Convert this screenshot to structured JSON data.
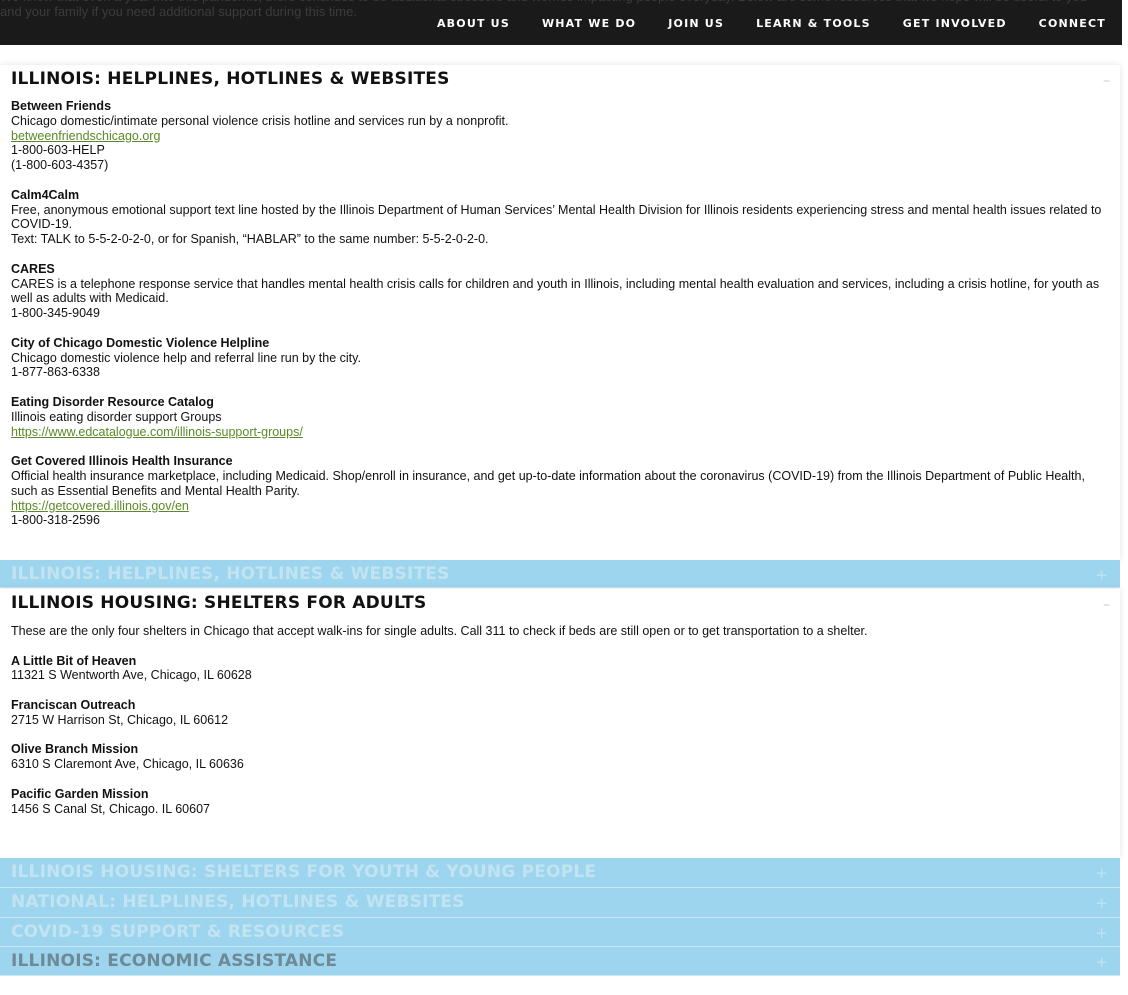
{
  "header": {
    "intro_text": "We know that even a year into this pandemic, there continues to be additional stressors and worries impacting people everyday. Below are some resources that we hope will be useful to you and your family if you need additional support during this time.",
    "nav": [
      "ABOUT US",
      "WHAT WE DO",
      "JOIN US",
      "LEARN & TOOLS",
      "GET INVOLVED",
      "CONNECT"
    ]
  },
  "panel1": {
    "title": "ILLINOIS: HELPLINES, HOTLINES & WEBSITES",
    "toggle": "–",
    "entries": [
      {
        "name": "Between Friends",
        "lines": [
          "Chicago domestic/intimate personal violence crisis hotline and services run by a nonprofit."
        ],
        "link": "betweenfriendschicago.org ",
        "after": [
          "1-800-603-HELP",
          "(1-800-603-4357)"
        ]
      },
      {
        "name": "Calm4Calm",
        "lines": [
          "Free, anonymous emotional support text line hosted by the Illinois Department of Human Services’ Mental Health Division for Illinois residents experiencing stress and mental health issues related to COVID-19.",
          "Text: TALK to 5-5-2-0-2-0, or for Spanish, “HABLAR” to the same number: 5-5-2-0-2-0."
        ]
      },
      {
        "name": "CARES",
        "lines": [
          "CARES is a telephone response service that handles mental health crisis calls for children and youth in Illinois, including mental health evaluation and services, including a crisis hotline, for youth as well as adults with Medicaid.",
          "1-800-345-9049"
        ]
      },
      {
        "name": "City of Chicago Domestic Violence Helpline",
        "lines": [
          "Chicago domestic violence help and referral line run by the city.",
          "1-877-863-6338"
        ]
      },
      {
        "name": "Eating Disorder Resource Catalog",
        "lines": [
          "Illinois eating disorder support Groups"
        ],
        "link": "https://www.edcatalogue.com/illinois-support-groups/"
      },
      {
        "name": "Get Covered Illinois Health Insurance",
        "lines": [
          "Official health insurance marketplace, including Medicaid. Shop/enroll in insurance, and get up-to-date information about the coronavirus (COVID-19) from the Illinois Department of Public Health, such as Essential Benefits and Mental Health Parity."
        ],
        "link": "https://getcovered.illinois.gov/en",
        "after": [
          "1-800-318-2596"
        ]
      }
    ]
  },
  "bar1": {
    "title": "ILLINOIS: HELPLINES, HOTLINES & WEBSITES",
    "toggle": "+"
  },
  "panel2": {
    "title": "ILLINOIS HOUSING: SHELTERS FOR ADULTS",
    "toggle": "–",
    "intro": "These are the only four shelters in Chicago that accept walk-ins for single adults. Call 311 to check if beds are still open or to get transportation to a shelter.",
    "entries": [
      {
        "name": "A Little Bit of Heaven",
        "address": "11321 S Wentworth Ave, Chicago, IL 60628"
      },
      {
        "name": "Franciscan Outreach",
        "address": "2715 W Harrison St, Chicago, IL 60612"
      },
      {
        "name": "Olive Branch Mission",
        "address": "6310 S Claremont Ave, Chicago, IL 60636"
      },
      {
        "name": "Pacific Garden Mission",
        "address": "1456 S Canal St, Chicago. IL 60607"
      }
    ]
  },
  "bars": [
    {
      "title": "ILLINOIS HOUSING: SHELTERS FOR YOUTH & YOUNG PEOPLE",
      "toggle": "+"
    },
    {
      "title": "NATIONAL: HELPLINES, HOTLINES & WEBSITES",
      "toggle": "+"
    },
    {
      "title": "COVID-19 SUPPORT & RESOURCES",
      "toggle": "+"
    },
    {
      "title": "ILLINOIS: ECONOMIC ASSISTANCE",
      "toggle": "+"
    }
  ]
}
